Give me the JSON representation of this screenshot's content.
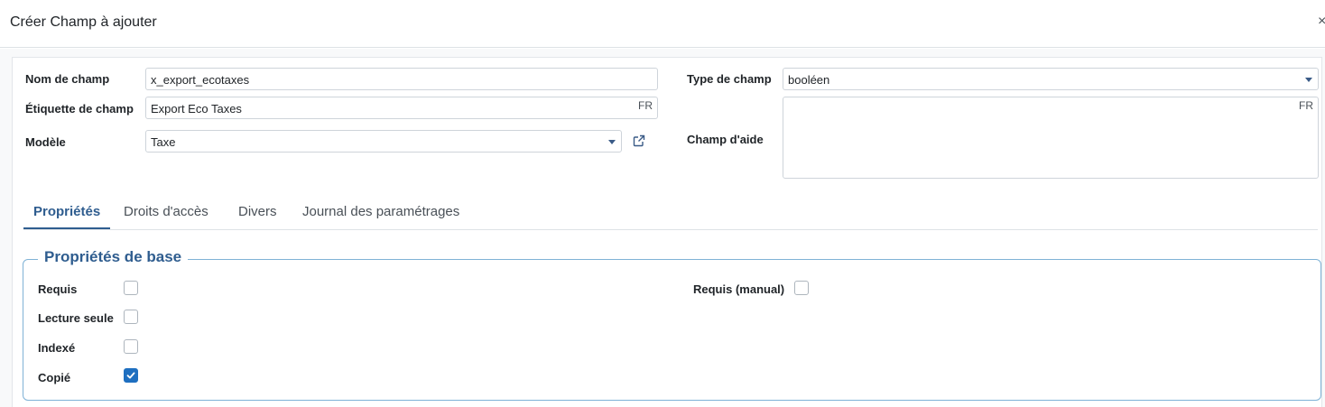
{
  "dialog": {
    "title": "Créer Champ à ajouter",
    "close_glyph": "×"
  },
  "form": {
    "field_name": {
      "label": "Nom de champ",
      "value": "x_export_ecotaxes"
    },
    "field_label": {
      "label": "Étiquette de champ",
      "value": "Export Eco Taxes",
      "lang": "FR"
    },
    "model": {
      "label": "Modèle",
      "value": "Taxe"
    },
    "field_type": {
      "label": "Type de champ",
      "value": "booléen"
    },
    "help": {
      "label": "Champ d'aide",
      "value": "",
      "lang": "FR"
    }
  },
  "tabs": [
    {
      "label": "Propriétés",
      "active": true
    },
    {
      "label": "Droits d'accès",
      "active": false
    },
    {
      "label": "Divers",
      "active": false
    },
    {
      "label": "Journal des paramétrages",
      "active": false
    }
  ],
  "base_properties": {
    "title": "Propriétés de base",
    "items": [
      {
        "label": "Requis",
        "checked": false
      },
      {
        "label": "Lecture seule",
        "checked": false
      },
      {
        "label": "Indexé",
        "checked": false
      },
      {
        "label": "Copié",
        "checked": true
      },
      {
        "label": "Requis (manual)",
        "checked": false
      }
    ]
  },
  "colors": {
    "accent": "#2f5d8f",
    "checkbox_checked": "#1e6fc0",
    "fieldset_border": "#7fb2d6"
  },
  "icons": {
    "external_link": "external-link-icon",
    "dropdown": "caret-down-icon",
    "check": "check-icon",
    "close": "close-icon"
  }
}
